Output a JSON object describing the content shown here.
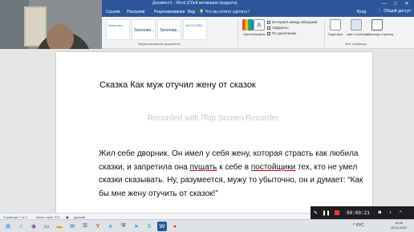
{
  "window": {
    "title": "Документ1 - Word (Сбой активации продукта)",
    "controls": [
      "—",
      "□",
      "✕"
    ]
  },
  "ribbon_tabs": [
    {
      "label": "Ссылки"
    },
    {
      "label": "Рассылки"
    },
    {
      "label": "Рецензирование"
    },
    {
      "label": "Вид"
    }
  ],
  "tell_me": "Что вы хотите сделать?",
  "sign_in": "Вход",
  "share": "Общий доступ",
  "styles_gallery": [
    {
      "preview": "Заголово..."
    },
    {
      "preview": "Заголово..."
    },
    {
      "preview": "Заголово..."
    },
    {
      "preview": "ЗАГОЛОВО..."
    }
  ],
  "ribbon_groups": {
    "format_label": "Форматирование документа",
    "page_bg_label": "Фон страницы"
  },
  "ribbon_buttons": {
    "colors": "Цвета",
    "fonts": "Шрифты",
    "paragraph_spacing": "Интервал между абзацами",
    "effects": "Эффекты",
    "set_default": "По умолчанию",
    "watermark": "Подложка",
    "page_color": "Цвет страницы",
    "page_borders": "Границы страниц"
  },
  "document": {
    "heading": "Сказка  Как муж отучил жену от сказок",
    "watermark": "Recorded with iTop Screen Recorder",
    "body_part1": "Жил себе дворник. Он имел у себя жену, которая страсть как любила сказки, и запретила она ",
    "body_u1": "пущать",
    "body_part2": " к себе в ",
    "body_u2": "постойщики",
    "body_part3": " тех, кто не умел сказки сказывать. Ну, разумеется, мужу то убыточно, он и думает: “Как бы мне жену отучить от сказок!”"
  },
  "status_bar": {
    "page": "Страница 1 из 2",
    "words": "Число слов: 271",
    "language": "русский"
  },
  "recorder": {
    "time": "00:00:21"
  },
  "taskbar": {
    "clock_time": "14:33",
    "clock_date": "15.01.2022",
    "tray": "^ РУС"
  },
  "colors": {
    "word_blue": "#2b579a",
    "recorder_bg": "#1e1e1e",
    "record_red": "#e53935"
  }
}
